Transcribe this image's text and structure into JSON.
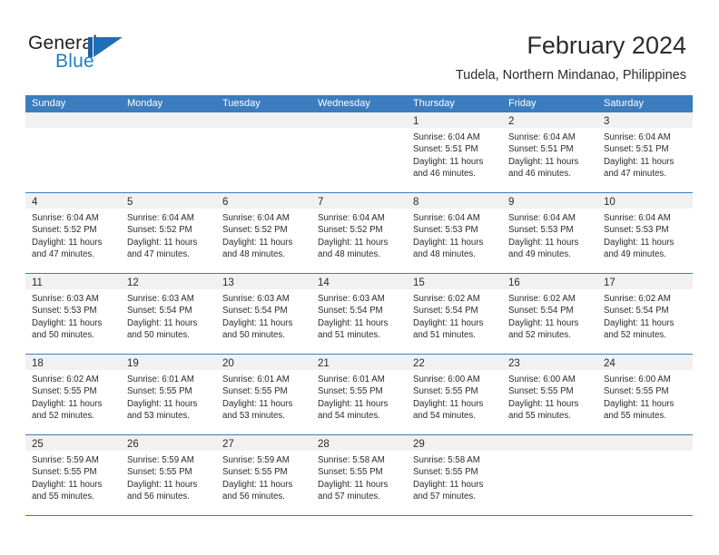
{
  "brand": {
    "word_one": "General",
    "word_two": "Blue",
    "mark": "triangle-flag-logo",
    "accent_color": "#1f6fb5"
  },
  "header": {
    "month_title": "February 2024",
    "location": "Tudela, Northern Mindanao, Philippines"
  },
  "calendar": {
    "header_bg": "#3b7dbf",
    "weekdays": [
      "Sunday",
      "Monday",
      "Tuesday",
      "Wednesday",
      "Thursday",
      "Friday",
      "Saturday"
    ],
    "weeks": [
      [
        {
          "day": "",
          "lines": []
        },
        {
          "day": "",
          "lines": []
        },
        {
          "day": "",
          "lines": []
        },
        {
          "day": "",
          "lines": []
        },
        {
          "day": "1",
          "lines": [
            "Sunrise: 6:04 AM",
            "Sunset: 5:51 PM",
            "Daylight: 11 hours",
            "and 46 minutes."
          ]
        },
        {
          "day": "2",
          "lines": [
            "Sunrise: 6:04 AM",
            "Sunset: 5:51 PM",
            "Daylight: 11 hours",
            "and 46 minutes."
          ]
        },
        {
          "day": "3",
          "lines": [
            "Sunrise: 6:04 AM",
            "Sunset: 5:51 PM",
            "Daylight: 11 hours",
            "and 47 minutes."
          ]
        }
      ],
      [
        {
          "day": "4",
          "lines": [
            "Sunrise: 6:04 AM",
            "Sunset: 5:52 PM",
            "Daylight: 11 hours",
            "and 47 minutes."
          ]
        },
        {
          "day": "5",
          "lines": [
            "Sunrise: 6:04 AM",
            "Sunset: 5:52 PM",
            "Daylight: 11 hours",
            "and 47 minutes."
          ]
        },
        {
          "day": "6",
          "lines": [
            "Sunrise: 6:04 AM",
            "Sunset: 5:52 PM",
            "Daylight: 11 hours",
            "and 48 minutes."
          ]
        },
        {
          "day": "7",
          "lines": [
            "Sunrise: 6:04 AM",
            "Sunset: 5:52 PM",
            "Daylight: 11 hours",
            "and 48 minutes."
          ]
        },
        {
          "day": "8",
          "lines": [
            "Sunrise: 6:04 AM",
            "Sunset: 5:53 PM",
            "Daylight: 11 hours",
            "and 48 minutes."
          ]
        },
        {
          "day": "9",
          "lines": [
            "Sunrise: 6:04 AM",
            "Sunset: 5:53 PM",
            "Daylight: 11 hours",
            "and 49 minutes."
          ]
        },
        {
          "day": "10",
          "lines": [
            "Sunrise: 6:04 AM",
            "Sunset: 5:53 PM",
            "Daylight: 11 hours",
            "and 49 minutes."
          ]
        }
      ],
      [
        {
          "day": "11",
          "lines": [
            "Sunrise: 6:03 AM",
            "Sunset: 5:53 PM",
            "Daylight: 11 hours",
            "and 50 minutes."
          ]
        },
        {
          "day": "12",
          "lines": [
            "Sunrise: 6:03 AM",
            "Sunset: 5:54 PM",
            "Daylight: 11 hours",
            "and 50 minutes."
          ]
        },
        {
          "day": "13",
          "lines": [
            "Sunrise: 6:03 AM",
            "Sunset: 5:54 PM",
            "Daylight: 11 hours",
            "and 50 minutes."
          ]
        },
        {
          "day": "14",
          "lines": [
            "Sunrise: 6:03 AM",
            "Sunset: 5:54 PM",
            "Daylight: 11 hours",
            "and 51 minutes."
          ]
        },
        {
          "day": "15",
          "lines": [
            "Sunrise: 6:02 AM",
            "Sunset: 5:54 PM",
            "Daylight: 11 hours",
            "and 51 minutes."
          ]
        },
        {
          "day": "16",
          "lines": [
            "Sunrise: 6:02 AM",
            "Sunset: 5:54 PM",
            "Daylight: 11 hours",
            "and 52 minutes."
          ]
        },
        {
          "day": "17",
          "lines": [
            "Sunrise: 6:02 AM",
            "Sunset: 5:54 PM",
            "Daylight: 11 hours",
            "and 52 minutes."
          ]
        }
      ],
      [
        {
          "day": "18",
          "lines": [
            "Sunrise: 6:02 AM",
            "Sunset: 5:55 PM",
            "Daylight: 11 hours",
            "and 52 minutes."
          ]
        },
        {
          "day": "19",
          "lines": [
            "Sunrise: 6:01 AM",
            "Sunset: 5:55 PM",
            "Daylight: 11 hours",
            "and 53 minutes."
          ]
        },
        {
          "day": "20",
          "lines": [
            "Sunrise: 6:01 AM",
            "Sunset: 5:55 PM",
            "Daylight: 11 hours",
            "and 53 minutes."
          ]
        },
        {
          "day": "21",
          "lines": [
            "Sunrise: 6:01 AM",
            "Sunset: 5:55 PM",
            "Daylight: 11 hours",
            "and 54 minutes."
          ]
        },
        {
          "day": "22",
          "lines": [
            "Sunrise: 6:00 AM",
            "Sunset: 5:55 PM",
            "Daylight: 11 hours",
            "and 54 minutes."
          ]
        },
        {
          "day": "23",
          "lines": [
            "Sunrise: 6:00 AM",
            "Sunset: 5:55 PM",
            "Daylight: 11 hours",
            "and 55 minutes."
          ]
        },
        {
          "day": "24",
          "lines": [
            "Sunrise: 6:00 AM",
            "Sunset: 5:55 PM",
            "Daylight: 11 hours",
            "and 55 minutes."
          ]
        }
      ],
      [
        {
          "day": "25",
          "lines": [
            "Sunrise: 5:59 AM",
            "Sunset: 5:55 PM",
            "Daylight: 11 hours",
            "and 55 minutes."
          ]
        },
        {
          "day": "26",
          "lines": [
            "Sunrise: 5:59 AM",
            "Sunset: 5:55 PM",
            "Daylight: 11 hours",
            "and 56 minutes."
          ]
        },
        {
          "day": "27",
          "lines": [
            "Sunrise: 5:59 AM",
            "Sunset: 5:55 PM",
            "Daylight: 11 hours",
            "and 56 minutes."
          ]
        },
        {
          "day": "28",
          "lines": [
            "Sunrise: 5:58 AM",
            "Sunset: 5:55 PM",
            "Daylight: 11 hours",
            "and 57 minutes."
          ]
        },
        {
          "day": "29",
          "lines": [
            "Sunrise: 5:58 AM",
            "Sunset: 5:55 PM",
            "Daylight: 11 hours",
            "and 57 minutes."
          ]
        },
        {
          "day": "",
          "lines": []
        },
        {
          "day": "",
          "lines": []
        }
      ]
    ]
  }
}
